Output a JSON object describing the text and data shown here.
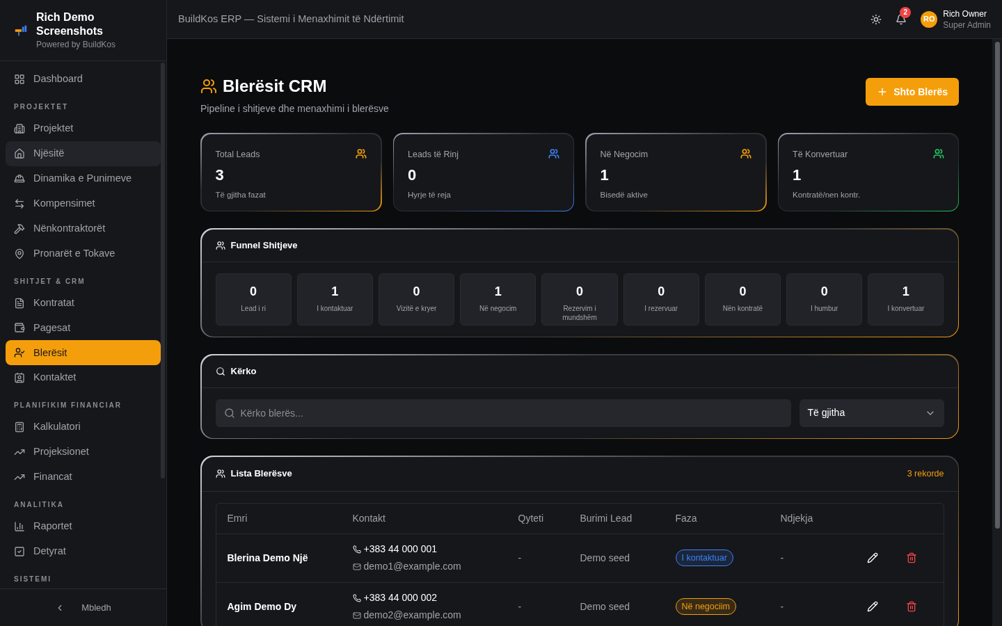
{
  "brand": {
    "title": "Rich Demo Screenshots",
    "subtitle": "Powered by BuildKos"
  },
  "sidebar": {
    "items": [
      {
        "label": "Dashboard",
        "kind": "item",
        "selected": false,
        "hovered": false
      },
      {
        "label": "PROJEKTET",
        "kind": "section"
      },
      {
        "label": "Projektet",
        "kind": "item",
        "selected": false,
        "hovered": false
      },
      {
        "label": "Njësitë",
        "kind": "item",
        "selected": false,
        "hovered": true
      },
      {
        "label": "Dinamika e Punimeve",
        "kind": "item",
        "selected": false,
        "hovered": false
      },
      {
        "label": "Kompensimet",
        "kind": "item",
        "selected": false,
        "hovered": false
      },
      {
        "label": "Nënkontraktorët",
        "kind": "item",
        "selected": false,
        "hovered": false
      },
      {
        "label": "Pronarët e Tokave",
        "kind": "item",
        "selected": false,
        "hovered": false
      },
      {
        "label": "SHITJET & CRM",
        "kind": "section"
      },
      {
        "label": "Kontratat",
        "kind": "item",
        "selected": false,
        "hovered": false
      },
      {
        "label": "Pagesat",
        "kind": "item",
        "selected": false,
        "hovered": false
      },
      {
        "label": "Blerësit",
        "kind": "item",
        "selected": true,
        "hovered": false
      },
      {
        "label": "Kontaktet",
        "kind": "item",
        "selected": false,
        "hovered": false
      },
      {
        "label": "PLANIFIKIM FINANCIAR",
        "kind": "section"
      },
      {
        "label": "Kalkulatori",
        "kind": "item",
        "selected": false,
        "hovered": false
      },
      {
        "label": "Projeksionet",
        "kind": "item",
        "selected": false,
        "hovered": false
      },
      {
        "label": "Financat",
        "kind": "item",
        "selected": false,
        "hovered": false
      },
      {
        "label": "ANALITIKA",
        "kind": "section"
      },
      {
        "label": "Raportet",
        "kind": "item",
        "selected": false,
        "hovered": false
      },
      {
        "label": "Detyrat",
        "kind": "item",
        "selected": false,
        "hovered": false
      },
      {
        "label": "SISTEMI",
        "kind": "section"
      }
    ],
    "collapse": "Mbledh"
  },
  "header": {
    "title": "BuildKos ERP — Sistemi i Menaxhimit të Ndërtimit",
    "notifications": "2",
    "user": {
      "initials": "RO",
      "name": "Rich Owner",
      "role": "Super Admin"
    }
  },
  "page": {
    "title": "Blerësit CRM",
    "subtitle": "Pipeline i shitjeve dhe menaxhimi i blerësve",
    "add_button": "Shto Blerës"
  },
  "stats": [
    {
      "label": "Total Leads",
      "value": "3",
      "note": "Të gjitha fazat",
      "color": "#f59e0b"
    },
    {
      "label": "Leads të Rinj",
      "value": "0",
      "note": "Hyrje të reja",
      "color": "#3b82f6"
    },
    {
      "label": "Në Negocim",
      "value": "1",
      "note": "Bisedë aktive",
      "color": "#f59e0b"
    },
    {
      "label": "Të Konvertuar",
      "value": "1",
      "note": "Kontratë/nen kontr.",
      "color": "#22c55e"
    }
  ],
  "funnel": {
    "title": "Funnel Shitjeve",
    "stages": [
      {
        "count": "0",
        "label": "Lead i ri"
      },
      {
        "count": "1",
        "label": "I kontaktuar"
      },
      {
        "count": "0",
        "label": "Vizitë e kryer"
      },
      {
        "count": "1",
        "label": "Në negocim"
      },
      {
        "count": "0",
        "label": "Rezervim i mundshëm"
      },
      {
        "count": "0",
        "label": "I rezervuar"
      },
      {
        "count": "0",
        "label": "Nën kontratë"
      },
      {
        "count": "0",
        "label": "I humbur"
      },
      {
        "count": "1",
        "label": "I konvertuar"
      }
    ]
  },
  "search": {
    "title": "Kërko",
    "placeholder": "Kërko blerës...",
    "filter": "Të gjitha"
  },
  "table": {
    "title": "Lista Blerësve",
    "count": "3 rekorde",
    "columns": [
      "Emri",
      "Kontakt",
      "Qyteti",
      "Burimi Lead",
      "Faza",
      "Ndjekja"
    ],
    "rows": [
      {
        "name": "Blerina Demo Një",
        "phone": "+383 44 000 001",
        "email": "demo1@example.com",
        "city": "-",
        "source": "Demo seed",
        "stage": "I kontaktuar",
        "color": "#3b82f6",
        "followup": "-"
      },
      {
        "name": "Agim Demo Dy",
        "phone": "+383 44 000 002",
        "email": "demo2@example.com",
        "city": "-",
        "source": "Demo seed",
        "stage": "Në negociim",
        "color": "#f59e0b",
        "followup": "-"
      }
    ]
  }
}
